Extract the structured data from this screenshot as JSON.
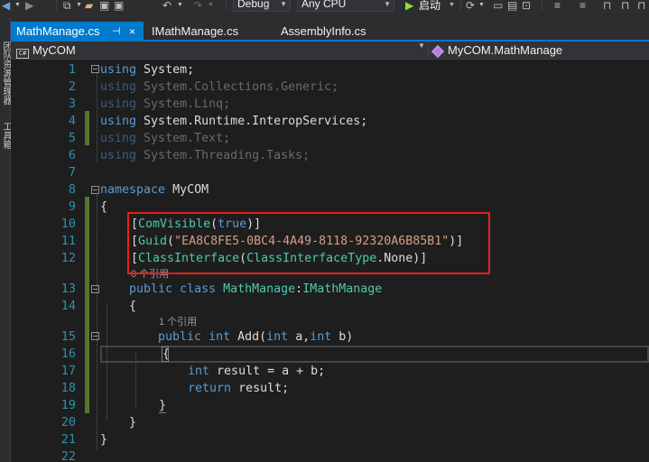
{
  "toolbar": {
    "config": "Debug",
    "platform": "Any CPU",
    "start_label": "启动",
    "start_icon": "play-icon"
  },
  "side_strip": {
    "items": [
      "团队资源管理器",
      "工具箱"
    ]
  },
  "tabs": [
    {
      "label": "MathManage.cs",
      "active": true,
      "pin": "⊣",
      "close": "×"
    },
    {
      "label": "IMathManage.cs",
      "active": false
    },
    {
      "label": "AssemblyInfo.cs",
      "active": false
    }
  ],
  "nav": {
    "project": "MyCOM",
    "project_icon": "C#",
    "member": "MyCOM.MathManage"
  },
  "code": {
    "lines": [
      "1",
      "2",
      "3",
      "4",
      "5",
      "6",
      "7",
      "8",
      "9",
      "10",
      "11",
      "12",
      "13",
      "14",
      "15",
      "16",
      "17",
      "18",
      "19",
      "20",
      "21",
      "22"
    ],
    "using_kw": "using",
    "ns_system": "System;",
    "ns_collections": "System.Collections.Generic;",
    "ns_linq": "System.Linq;",
    "ns_interop": "System.Runtime.InteropServices;",
    "ns_text": "System.Text;",
    "ns_tasks": "System.Threading.Tasks;",
    "namespace_kw": "namespace",
    "namespace_name": "MyCOM",
    "brace_open": "{",
    "brace_close": "}",
    "attr1_open": "[",
    "attr1_name": "ComVisible",
    "attr1_paren": "(",
    "attr1_value": "true",
    "attr1_close": ")]",
    "attr2_open": "[",
    "attr2_name": "Guid",
    "attr2_paren": "(",
    "attr2_value": "\"EA8C8FE5-0BC4-4A49-8118-92320A6B85B1\"",
    "attr2_close": ")]",
    "attr3_open": "[",
    "attr3_name": "ClassInterface",
    "attr3_paren": "(",
    "attr3_enum": "ClassInterfaceType",
    "attr3_member": ".None",
    "attr3_close": ")]",
    "lens_class": "0 个引用",
    "lens_method": "1 个引用",
    "public_kw": "public",
    "class_kw": "class",
    "class_name": "MathManage",
    "colon": ":",
    "interface_name": "IMathManage",
    "int_kw": "int",
    "method_name": "Add(",
    "param_a": "a,",
    "param_b": "b)",
    "var_result": "result = a + b;",
    "return_kw": "return",
    "return_val": "result;"
  },
  "colors": {
    "keyword": "#569cd6",
    "type": "#4ec9b0",
    "string": "#d69d85",
    "line_number": "#2b91af",
    "highlight_box": "#e51f1f",
    "accent": "#007acc"
  }
}
